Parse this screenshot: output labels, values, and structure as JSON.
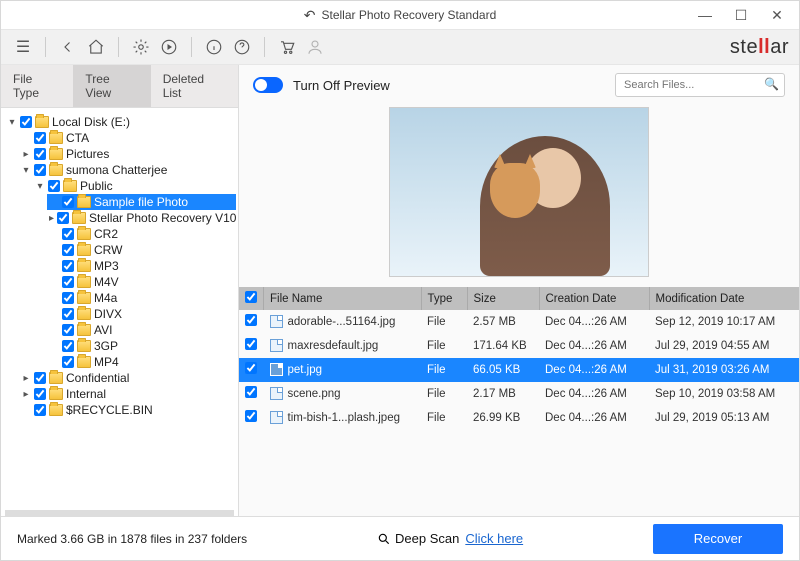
{
  "window": {
    "title": "Stellar Photo Recovery Standard"
  },
  "logo": {
    "pre": "ste",
    "mid": "ll",
    "post": "ar"
  },
  "sidebar": {
    "tabs": {
      "file_type": "File Type",
      "tree_view": "Tree View",
      "deleted_list": "Deleted List"
    },
    "root": "Local Disk (E:)",
    "level1": {
      "cta": "CTA",
      "pictures": "Pictures",
      "sumona": "sumona Chatterjee",
      "confidential": "Confidential",
      "internal": "Internal",
      "recycle": "$RECYCLE.BIN"
    },
    "public": "Public",
    "public_children": {
      "sample": "Sample file Photo",
      "stellarv10": "Stellar Photo Recovery V10",
      "cr2": "CR2",
      "crw": "CRW",
      "mp3": "MP3",
      "m4v": "M4V",
      "m4a": "M4a",
      "divx": "DIVX",
      "avi": "AVI",
      "tgp": "3GP",
      "mp4": "MP4"
    }
  },
  "preview": {
    "toggle_label": "Turn Off Preview"
  },
  "search": {
    "placeholder": "Search Files..."
  },
  "table": {
    "headers": {
      "fn": "File Name",
      "type": "Type",
      "size": "Size",
      "cd": "Creation Date",
      "md": "Modification Date"
    },
    "rows": [
      {
        "name": "adorable-...51164.jpg",
        "type": "File",
        "size": "2.57 MB",
        "cd": "Dec 04...:26 AM",
        "md": "Sep 12, 2019 10:17 AM"
      },
      {
        "name": "maxresdefault.jpg",
        "type": "File",
        "size": "171.64 KB",
        "cd": "Dec 04...:26 AM",
        "md": "Jul 29, 2019 04:55 AM"
      },
      {
        "name": "pet.jpg",
        "type": "File",
        "size": "66.05 KB",
        "cd": "Dec 04...:26 AM",
        "md": "Jul 31, 2019 03:26 AM"
      },
      {
        "name": "scene.png",
        "type": "File",
        "size": "2.17 MB",
        "cd": "Dec 04...:26 AM",
        "md": "Sep 10, 2019 03:58 AM"
      },
      {
        "name": "tim-bish-1...plash.jpeg",
        "type": "File",
        "size": "26.99 KB",
        "cd": "Dec 04...:26 AM",
        "md": "Jul 29, 2019 05:13 AM"
      }
    ],
    "selected_index": 2
  },
  "footer": {
    "status": "Marked 3.66 GB in 1878 files in 237 folders",
    "deepscan_label": "Deep Scan",
    "deepscan_link": "Click here",
    "recover": "Recover"
  }
}
